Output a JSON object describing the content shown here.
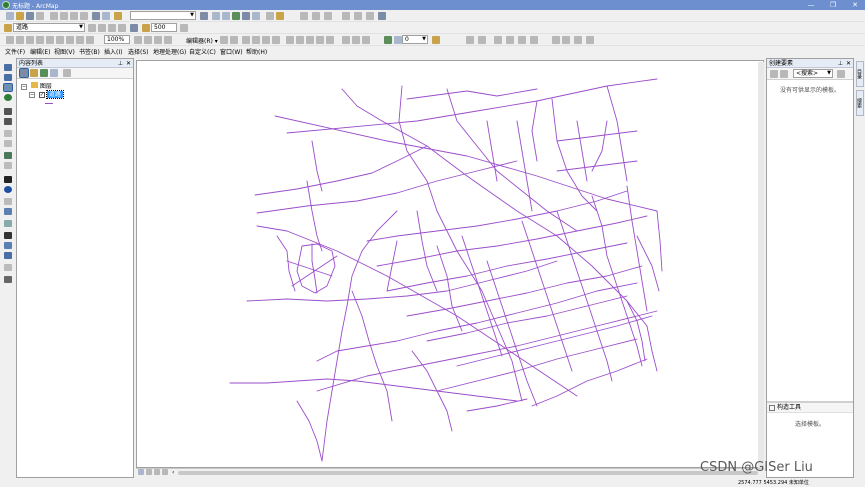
{
  "window": {
    "title": "无标题 - ArcMap"
  },
  "toolbar1": {
    "scale_value": ""
  },
  "toolbar2": {
    "layer_combo": "道路",
    "zoom_value": "100%",
    "scale_value2": "500"
  },
  "toolbar3": {
    "editor_label": "编辑器(R) ▾",
    "layer_value": "0"
  },
  "menu": {
    "items": [
      "文件(F)",
      "编辑(E)",
      "视图(V)",
      "书签(B)",
      "插入(I)",
      "选择(S)",
      "地理处理(G)",
      "自定义(C)",
      "窗口(W)",
      "帮助(H)"
    ]
  },
  "toc": {
    "title": "内容列表",
    "group_label": "图层",
    "layer_label": "道路"
  },
  "right_panel": {
    "title": "创建要素",
    "search_placeholder": "<搜索>",
    "empty_message": "没有可供显示的模板。",
    "construct_title": "构造工具",
    "construct_message": "选择模板。"
  },
  "right_dock": {
    "tab1": "目录",
    "tab2": "搜索"
  },
  "status": {
    "coords": "2574.777   5453.294 未知单位"
  },
  "watermark": {
    "text": "CSDN @GISer Liu"
  },
  "colors": {
    "road": "#9b4dca",
    "titlebar": "#6d8fcf",
    "layer_highlight": "#3399ff"
  }
}
